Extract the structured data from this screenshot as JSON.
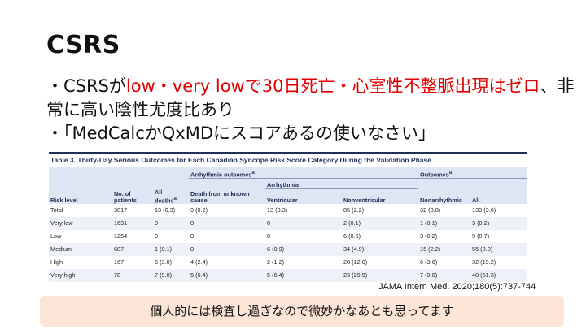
{
  "slide": {
    "title": "CSRS",
    "bullet1_prefix": "・CSRSが",
    "bullet1_red": "low・very lowで30日死亡・心室性不整脈出現はゼロ",
    "bullet1_suffix": "、非常に高い陰性尤度比あり",
    "bullet2": "・「MedCalcかQxMDにスコアあるの使いなさい」",
    "citation": "JAMA Intern Med. 2020;180(5):737-744",
    "note": "個人的には検査し過ぎなので微妙かなあとも思ってます",
    "red_color": "#e00000",
    "note_bg": "#fce4d6"
  },
  "table": {
    "caption": "Table 3. Thirty-Day Serious Outcomes for Each Canadian Syncope Risk Score Category During the Validation Phase",
    "group_arrhythmic": "Arrhythmic outcomes",
    "group_outcomes": "Outcomes",
    "sub_arrhythmia": "Arrhythmia",
    "sup": "a",
    "headers": {
      "risk_level": "Risk level",
      "patients_1": "No. of",
      "patients_2": "patients",
      "deaths_1": "All",
      "deaths_2": "deaths",
      "death_cause_1": "Death from unknown",
      "death_cause_2": "cause",
      "ventricular": "Ventricular",
      "nonventricular": "Nonventricular",
      "nonarrhythmic": "Nonarrhythmic",
      "all": "All"
    },
    "rows": [
      [
        "Total",
        "3817",
        "13 (0.3)",
        "9 (0.2)",
        "13 (0.3)",
        "85 (2.2)",
        "32 (0.8)",
        "139 (3.6)"
      ],
      [
        "Very low",
        "1631",
        "0",
        "0",
        "0",
        "2 (0.1)",
        "1 (0.1)",
        "3 (0.2)"
      ],
      [
        "Low",
        "1254",
        "0",
        "0",
        "0",
        "6 (0.5)",
        "3 (0.2)",
        "9 (0.7)"
      ],
      [
        "Medium",
        "687",
        "1 (0.1)",
        "0",
        "6 (0.9)",
        "34 (4.9)",
        "15 (2.2)",
        "55 (8.0)"
      ],
      [
        "High",
        "167",
        "5 (3.0)",
        "4 (2.4)",
        "2 (1.2)",
        "20 (12.0)",
        "6 (3.6)",
        "32 (19.2)"
      ],
      [
        "Very high",
        "78",
        "7 (9.0)",
        "5 (6.4)",
        "5 (6.4)",
        "23 (29.5)",
        "7 (9.0)",
        "40 (51.3)"
      ]
    ]
  }
}
